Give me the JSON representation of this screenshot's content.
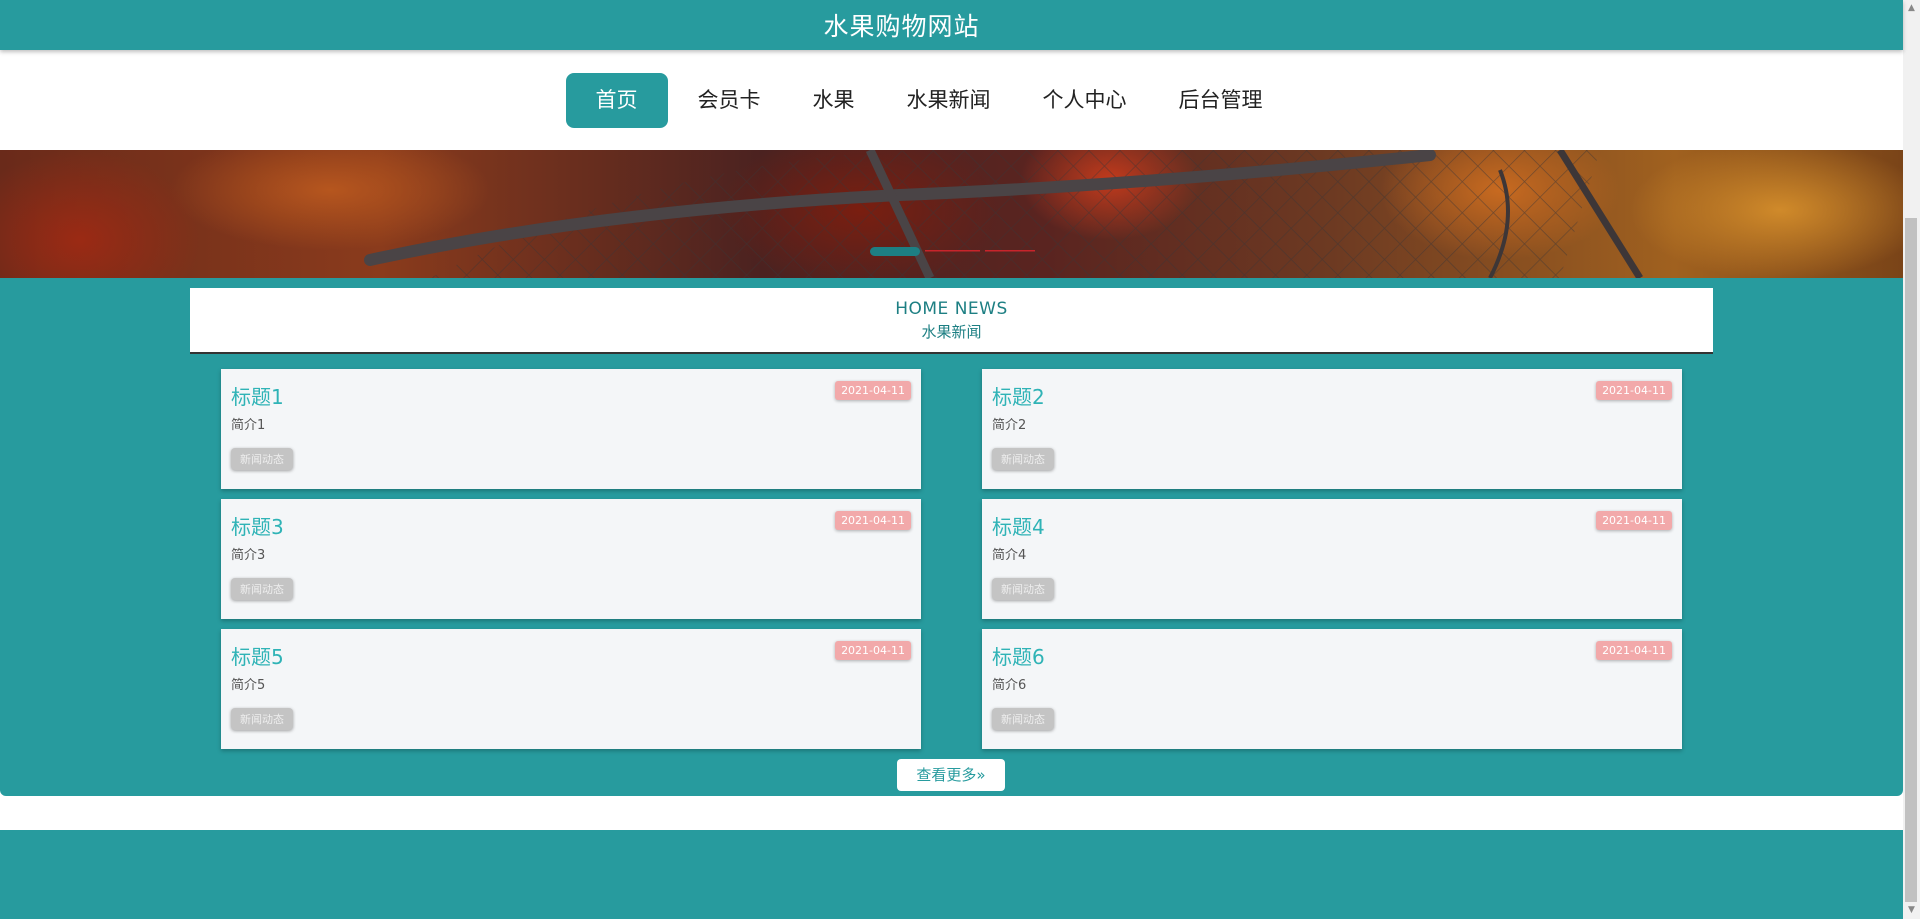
{
  "site": {
    "title": "水果购物网站"
  },
  "nav": {
    "items": [
      {
        "label": "首页"
      },
      {
        "label": "会员卡"
      },
      {
        "label": "水果"
      },
      {
        "label": "水果新闻"
      },
      {
        "label": "个人中心"
      },
      {
        "label": "后台管理"
      }
    ],
    "active_index": 0
  },
  "banner": {
    "slides_count": 3,
    "active_slide": 0
  },
  "news": {
    "title_en": "HOME NEWS",
    "title_cn": "水果新闻",
    "items": [
      {
        "title": "标题1",
        "intro": "简介1",
        "date": "2021-04-11",
        "tag": "新闻动态"
      },
      {
        "title": "标题2",
        "intro": "简介2",
        "date": "2021-04-11",
        "tag": "新闻动态"
      },
      {
        "title": "标题3",
        "intro": "简介3",
        "date": "2021-04-11",
        "tag": "新闻动态"
      },
      {
        "title": "标题4",
        "intro": "简介4",
        "date": "2021-04-11",
        "tag": "新闻动态"
      },
      {
        "title": "标题5",
        "intro": "简介5",
        "date": "2021-04-11",
        "tag": "新闻动态"
      },
      {
        "title": "标题6",
        "intro": "简介6",
        "date": "2021-04-11",
        "tag": "新闻动态"
      }
    ],
    "more_label": "查看更多",
    "more_icon": "double-chevron-right-icon"
  },
  "colors": {
    "primary": "#279b9e",
    "title_accent": "#2fb3b6",
    "date_badge": "#f2a9aa",
    "tag_badge": "#c4c4c4"
  }
}
